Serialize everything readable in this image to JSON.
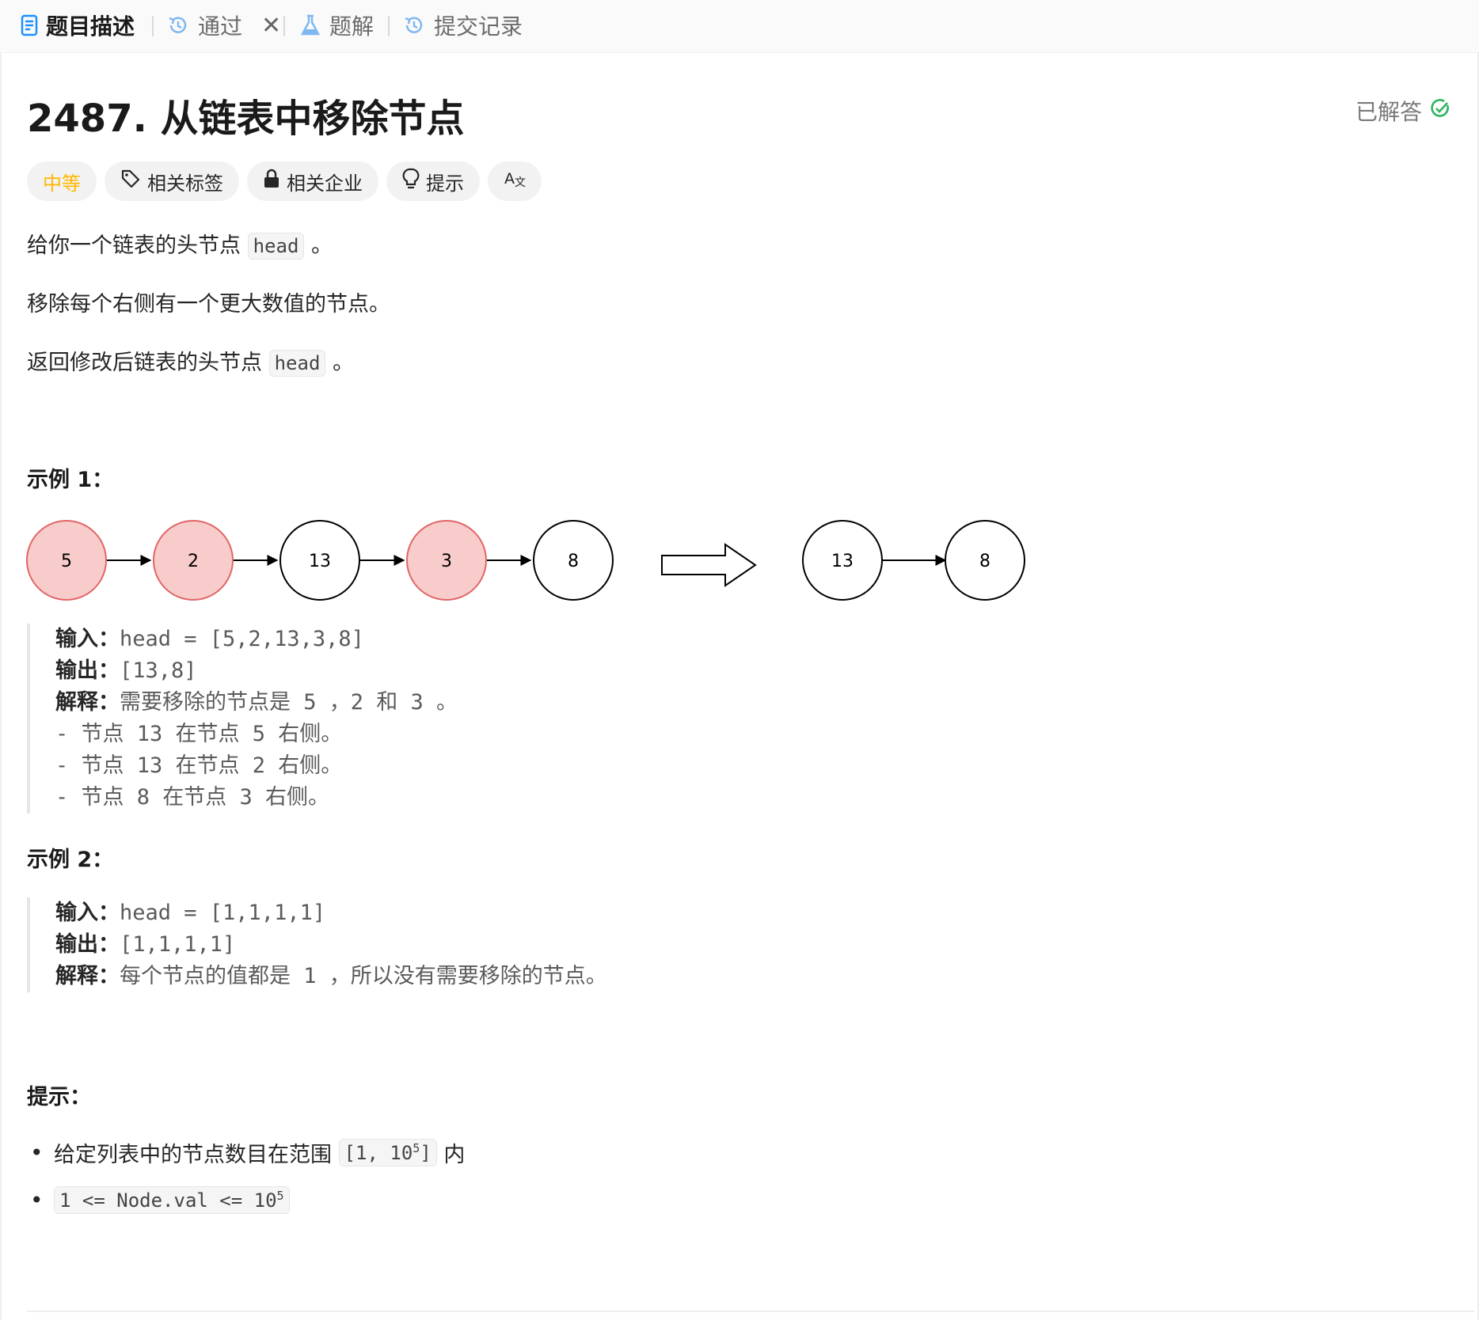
{
  "tabs": [
    {
      "label": "题目描述",
      "icon": "document-icon",
      "active": true
    },
    {
      "label": "通过",
      "icon": "history-icon",
      "closable": true
    },
    {
      "label": "题解",
      "icon": "flask-icon"
    },
    {
      "label": "提交记录",
      "icon": "history-icon"
    }
  ],
  "problem": {
    "title": "2487. 从链表中移除节点",
    "status": "已解答",
    "difficulty": "中等",
    "tags": [
      {
        "label": "相关标签",
        "icon": "tag-icon"
      },
      {
        "label": "相关企业",
        "icon": "lock-icon"
      },
      {
        "label": "提示",
        "icon": "lightbulb-icon"
      },
      {
        "label": "",
        "icon": "translate-icon"
      }
    ],
    "desc1_pre": "给你一个链表的头节点",
    "desc1_code": "head",
    "desc1_post": "。",
    "desc2": "移除每个右侧有一个更大数值的节点。",
    "desc3_pre": "返回修改后链表的头节点",
    "desc3_code": "head",
    "desc3_post": "。",
    "ex1_title": "示例 1：",
    "ex1_lines": [
      {
        "label": "输入：",
        "text": "head = [5,2,13,3,8]"
      },
      {
        "label": "输出：",
        "text": "[13,8]"
      },
      {
        "label": "解释：",
        "text": "需要移除的节点是 5 ，2 和 3 。"
      },
      {
        "label": "",
        "text": "- 节点 13 在节点 5 右侧。"
      },
      {
        "label": "",
        "text": "- 节点 13 在节点 2 右侧。"
      },
      {
        "label": "",
        "text": "- 节点 8 在节点 3 右侧。"
      }
    ],
    "diagram": {
      "before": [
        {
          "v": "5",
          "removed": true
        },
        {
          "v": "2",
          "removed": true
        },
        {
          "v": "13",
          "removed": false
        },
        {
          "v": "3",
          "removed": true
        },
        {
          "v": "8",
          "removed": false
        }
      ],
      "after": [
        "13",
        "8"
      ],
      "removed_color": "#f9cccc",
      "removed_stroke": "#e06666"
    },
    "ex2_title": "示例 2：",
    "ex2_lines": [
      {
        "label": "输入：",
        "text": "head = [1,1,1,1]"
      },
      {
        "label": "输出：",
        "text": "[1,1,1,1]"
      },
      {
        "label": "解释：",
        "text": "每个节点的值都是 1 ，所以没有需要移除的节点。"
      }
    ],
    "hints_title": "提示：",
    "hint1_pre": "给定列表中的节点数目在范围",
    "hint1_code": "[1, 10",
    "hint1_sup": "5",
    "hint1_code_end": "]",
    "hint1_post": "内",
    "hint2_code": "1 <= Node.val <= 10",
    "hint2_sup": "5"
  },
  "colors": {
    "accent": "#1a90ff",
    "difficulty": "#ffb800",
    "solved": "#2db55d"
  }
}
